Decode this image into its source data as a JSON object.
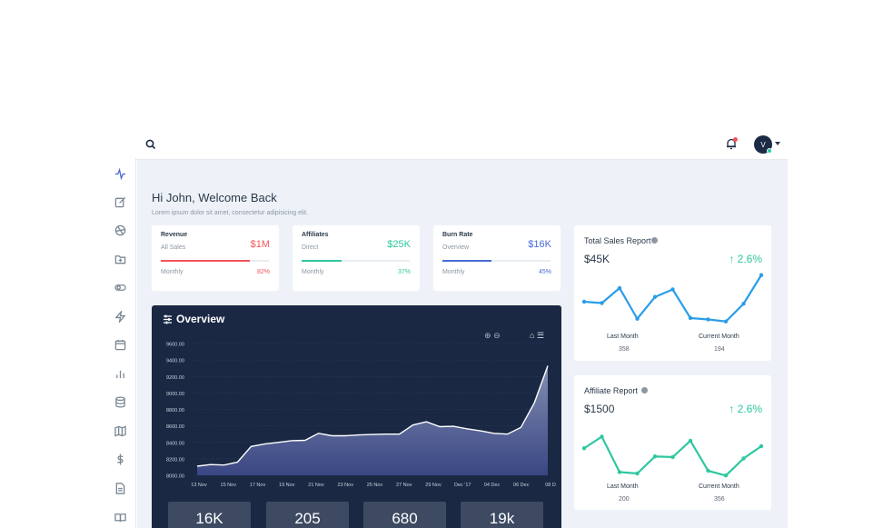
{
  "topbar": {
    "avatar_initial": "V"
  },
  "sidebar": {
    "icons": [
      "activity-icon",
      "edit-icon",
      "aperture-icon",
      "folder-plus-icon",
      "toggle-icon",
      "zap-icon",
      "calendar-icon",
      "bar-chart-icon",
      "database-icon",
      "map-icon",
      "dollar-icon",
      "file-text-icon",
      "book-icon"
    ],
    "active": "activity-icon"
  },
  "welcome": {
    "title": "Hi John, Welcome Back",
    "subtitle": "Lorem ipsum dolor sit amet, consectetur adipisicing elit."
  },
  "stats": [
    {
      "title": "Revenue",
      "sub": "All Sales",
      "value": "$1M",
      "period": "Monthly",
      "percent_label": "82%",
      "percent": 0.82,
      "color": "#f2545b"
    },
    {
      "title": "Affiliates",
      "sub": "Direct",
      "value": "$25K",
      "period": "Monthly",
      "percent_label": "37%",
      "percent": 0.37,
      "color": "#2ec7a0"
    },
    {
      "title": "Burn Rate",
      "sub": "Overview",
      "value": "$16K",
      "period": "Monthly",
      "percent_label": "45%",
      "percent": 0.45,
      "color": "#4a6ad8"
    }
  ],
  "overview": {
    "title": "Overview",
    "tiles": [
      "16K",
      "205",
      "680",
      "19k"
    ],
    "chart_data": {
      "type": "area",
      "title": "Overview",
      "y_ticks": [
        "9600.00",
        "9400.00",
        "9200.00",
        "9000.00",
        "8800.00",
        "8600.00",
        "8400.00",
        "8200.00",
        "8000.00"
      ],
      "ylim": [
        8000,
        9600
      ],
      "x_ticks": [
        "13 Nov",
        "15 Nov",
        "17 Nov",
        "19 Nov",
        "21 Nov",
        "23 Nov",
        "25 Nov",
        "27 Nov",
        "29 Nov",
        "Dec '17",
        "04 Dec",
        "06 Dec",
        "08 D"
      ],
      "values": [
        8110,
        8130,
        8125,
        8160,
        8350,
        8380,
        8400,
        8420,
        8425,
        8510,
        8480,
        8480,
        8490,
        8495,
        8500,
        8500,
        8610,
        8650,
        8590,
        8595,
        8565,
        8540,
        8510,
        8500,
        8580,
        8880,
        9330
      ],
      "grid": true
    }
  },
  "sales_report": {
    "title": "Total Sales Report",
    "value": "$45K",
    "change": "↑ 2.6%",
    "left_label": "Last Month",
    "left_value": "358",
    "right_label": "Current Month",
    "right_value": "194",
    "color": "#2a9de8",
    "chart_data": {
      "type": "line",
      "values": [
        40,
        38,
        60,
        15,
        47,
        58,
        16,
        14,
        11,
        37,
        79
      ]
    }
  },
  "affiliate_report": {
    "title": "Affiliate Report",
    "value": "$1500",
    "change": "↑ 2.6%",
    "left_label": "Last Month",
    "left_value": "200",
    "right_label": "Current Month",
    "right_value": "356",
    "color": "#2ec7a0",
    "chart_data": {
      "type": "line",
      "values": [
        45,
        62,
        10,
        8,
        33,
        32,
        56,
        12,
        5,
        30,
        48
      ]
    }
  }
}
